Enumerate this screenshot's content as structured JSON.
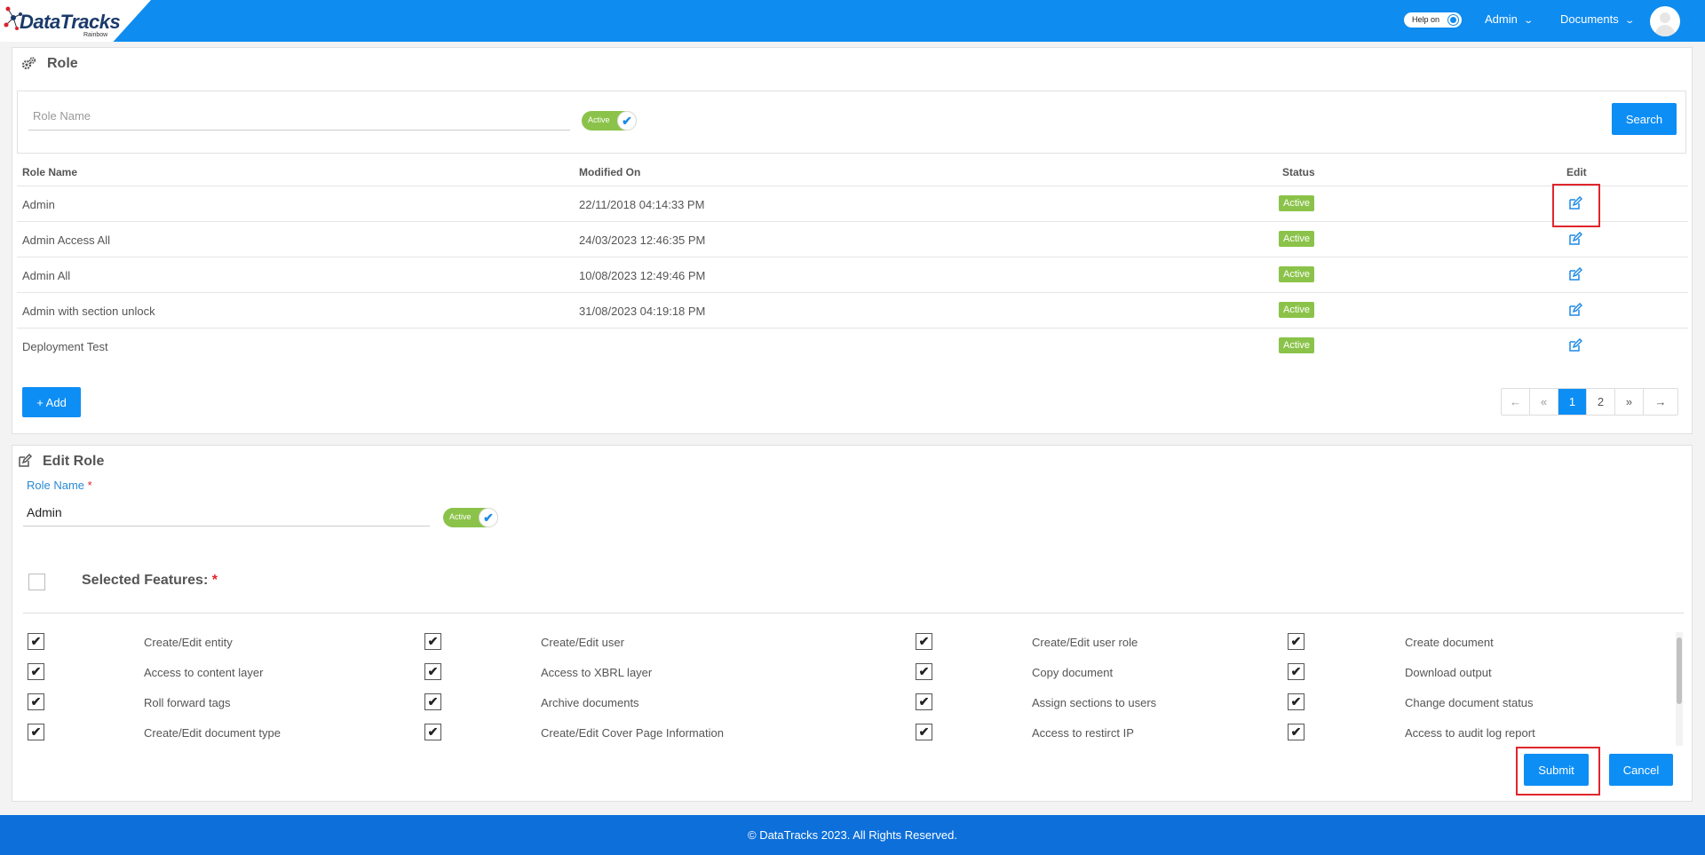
{
  "header": {
    "logo_main": "DataTracks",
    "logo_sub": "Rainbow",
    "help_label": "Help on",
    "admin_menu": "Admin",
    "documents_menu": "Documents"
  },
  "role_panel": {
    "title": "Role",
    "search_placeholder": "Role Name",
    "active_label": "Active",
    "search_button": "Search",
    "columns": [
      "Role Name",
      "Modified On",
      "Status",
      "Edit"
    ],
    "rows": [
      {
        "name": "Admin",
        "modified": "22/11/2018 04:14:33 PM",
        "status": "Active"
      },
      {
        "name": "Admin Access All",
        "modified": "24/03/2023 12:46:35 PM",
        "status": "Active"
      },
      {
        "name": "Admin All",
        "modified": "10/08/2023 12:49:46 PM",
        "status": "Active"
      },
      {
        "name": "Admin with section unlock",
        "modified": "31/08/2023 04:19:18 PM",
        "status": "Active"
      },
      {
        "name": "Deployment Test",
        "modified": "",
        "status": "Active"
      }
    ],
    "add_button": "+ Add",
    "pagination": [
      "←",
      "«",
      "1",
      "2",
      "»",
      "→"
    ]
  },
  "edit_panel": {
    "title": "Edit Role",
    "role_name_label": "Role Name",
    "required_mark": "*",
    "role_name_value": "Admin",
    "active_label": "Active",
    "features_title": "Selected Features:",
    "features": [
      [
        "Create/Edit entity",
        "Create/Edit user",
        "Create/Edit user role",
        "Create document"
      ],
      [
        "Access to content layer",
        "Access to XBRL layer",
        "Copy document",
        "Download output"
      ],
      [
        "Roll forward tags",
        "Archive documents",
        "Assign sections to users",
        "Change document status"
      ],
      [
        "Create/Edit document type",
        "Create/Edit Cover Page Information",
        "Access to restirct IP",
        "Access to audit log report"
      ]
    ],
    "submit_button": "Submit",
    "cancel_button": "Cancel"
  },
  "footer": {
    "copyright": "© DataTracks 2023. All Rights Reserved."
  },
  "colors": {
    "header_blue": "#0f8cf0",
    "button_blue": "#0d8ef5",
    "active_green": "#8bc34a",
    "highlight_red": "#e0262c",
    "footer_blue": "#0d6fd9"
  }
}
